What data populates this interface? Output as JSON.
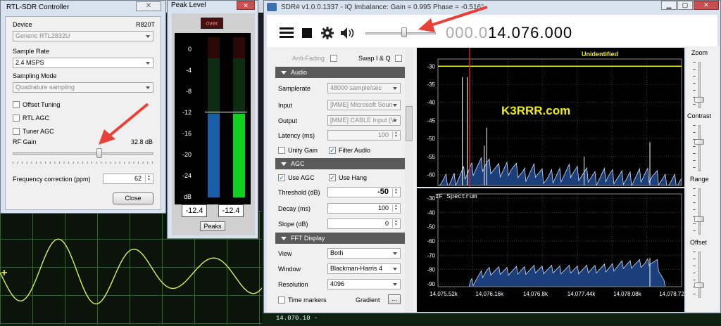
{
  "rtl": {
    "title": "RTL-SDR Controller",
    "device_label": "Device",
    "device_tuner": "R820T",
    "device_value": "Generic RTL2832U",
    "sample_rate_label": "Sample Rate",
    "sample_rate_value": "2.4 MSPS",
    "sampling_mode_label": "Sampling Mode",
    "sampling_mode_value": "Quadrature sampling",
    "offset_tuning": "Offset Tuning",
    "rtl_agc": "RTL AGC",
    "tuner_agc": "Tuner AGC",
    "rf_gain_label": "RF Gain",
    "rf_gain_value": "32.8 dB",
    "rf_gain_fraction": 0.62,
    "freq_corr_label": "Frequency correction (ppm)",
    "freq_corr_value": "62",
    "close": "Close"
  },
  "peak": {
    "title": "Peak Level",
    "over": "over",
    "ticks": [
      "0",
      "-4",
      "-8",
      "-12",
      "-16",
      "-20",
      "-24",
      "dB"
    ],
    "left_value": "-12.4",
    "right_value": "-12.4",
    "peaks_button": "Peaks",
    "left_level": -12.4,
    "right_level": -12.4
  },
  "sdr": {
    "title": "SDR# v1.0.0.1337 - IQ Imbalance: Gain = 0.995 Phase = -0.516°",
    "freq_dim": "000.0",
    "freq_main": "14.076.000",
    "volume_fraction": 0.55,
    "anti_fading": "Anti-Fading",
    "swap_iq": "Swap I & Q",
    "audio_header": "Audio",
    "samplerate_label": "Samplerate",
    "samplerate_value": "48000 sample/sec",
    "input_label": "Input",
    "input_value": "[MME] Microsoft Soun",
    "output_label": "Output",
    "output_value": "[MME] CABLE Input (V",
    "latency_label": "Latency (ms)",
    "latency_value": "100",
    "unity_gain": "Unity Gain",
    "filter_audio": "Filter Audio",
    "agc_header": "AGC",
    "use_agc": "Use AGC",
    "use_hang": "Use Hang",
    "threshold_label": "Threshold (dB)",
    "threshold_value": "-50",
    "decay_label": "Decay (ms)",
    "decay_value": "100",
    "slope_label": "Slope (dB)",
    "slope_value": "0",
    "fft_header": "FFT Display",
    "view_label": "View",
    "view_value": "Both",
    "window_label": "Window",
    "window_value": "Blackman-Harris 4",
    "resolution_label": "Resolution",
    "resolution_value": "4096",
    "time_markers": "Time markers",
    "gradient_label": "Gradient",
    "gradient_btn": "...",
    "spectrum_label": "Unidentified",
    "watermark": "K3RRR.com",
    "if_label": "IF Spectrum",
    "zoom_label": "Zoom",
    "contrast_label": "Contrast",
    "range_label": "Range",
    "offset_label": "Offset"
  },
  "chart_data": [
    {
      "type": "area",
      "name": "spectrum",
      "y_ticks": [
        "-30",
        "-35",
        "-40",
        "-45",
        "-50",
        "-55",
        "-60"
      ],
      "ylim": [
        -63,
        -28
      ],
      "x": [
        0,
        0.05,
        0.1,
        0.15,
        0.2,
        0.25,
        0.3,
        0.35,
        0.4,
        0.45,
        0.5,
        0.55,
        0.6,
        0.65,
        0.7,
        0.75,
        0.8,
        0.85,
        0.88,
        0.9,
        0.95,
        1.0
      ],
      "y": [
        -62,
        -62,
        -60,
        -58,
        -57,
        -59,
        -58,
        -60,
        -59,
        -61,
        -60,
        -59,
        -60,
        -61,
        -60,
        -61,
        -61,
        -60,
        -60,
        -61,
        -62,
        -62
      ]
    },
    {
      "type": "area",
      "name": "if_spectrum",
      "y_ticks": [
        "-30",
        "-40",
        "-50",
        "-60",
        "-70",
        "-80",
        "-90"
      ],
      "x_ticks": [
        "14,075.52k",
        "14,076.16k",
        "14,076.8k",
        "14,077.44k",
        "14,078.08k",
        "14,078.72k"
      ],
      "ylim": [
        -92,
        -27
      ],
      "x": [
        0.13,
        0.2,
        0.3,
        0.4,
        0.5,
        0.6,
        0.7,
        0.75,
        0.8,
        0.85,
        0.87,
        0.9,
        0.93
      ],
      "y": [
        -90,
        -81,
        -81,
        -80,
        -80,
        -80,
        -79,
        -77,
        -76,
        -76,
        -74,
        -76,
        -90
      ]
    }
  ]
}
